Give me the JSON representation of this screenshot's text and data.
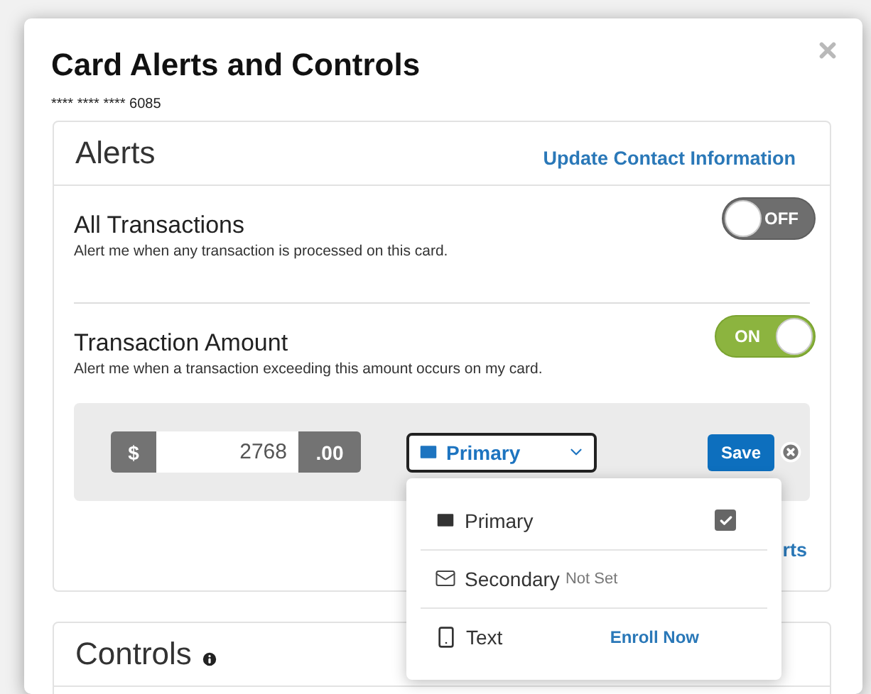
{
  "dialog": {
    "title": "Card Alerts and Controls",
    "card_number": "**** **** **** 6085"
  },
  "alerts": {
    "heading": "Alerts",
    "link": "Update Contact Information",
    "items": [
      {
        "title": "All Transactions",
        "description": "Alert me when any transaction is processed on this card.",
        "toggle_label": "OFF",
        "on": false
      },
      {
        "title": "Transaction Amount",
        "description": "Alert me when a transaction exceeding this amount occurs on my card.",
        "toggle_label": "ON",
        "on": true
      }
    ],
    "amount_editor": {
      "prefix": "$",
      "value": "2768",
      "suffix": ".00",
      "select_value": "Primary",
      "select_open": true,
      "save": "Save",
      "link_fragment": "rts"
    },
    "dropdown_options": [
      {
        "kind": "primary",
        "label": "Primary",
        "checked": true
      },
      {
        "kind": "secondary",
        "label": "Secondary",
        "note": "Not Set"
      },
      {
        "kind": "text",
        "label": "Text",
        "action": "Enroll Now"
      }
    ]
  },
  "controls": {
    "heading": "Controls"
  }
}
